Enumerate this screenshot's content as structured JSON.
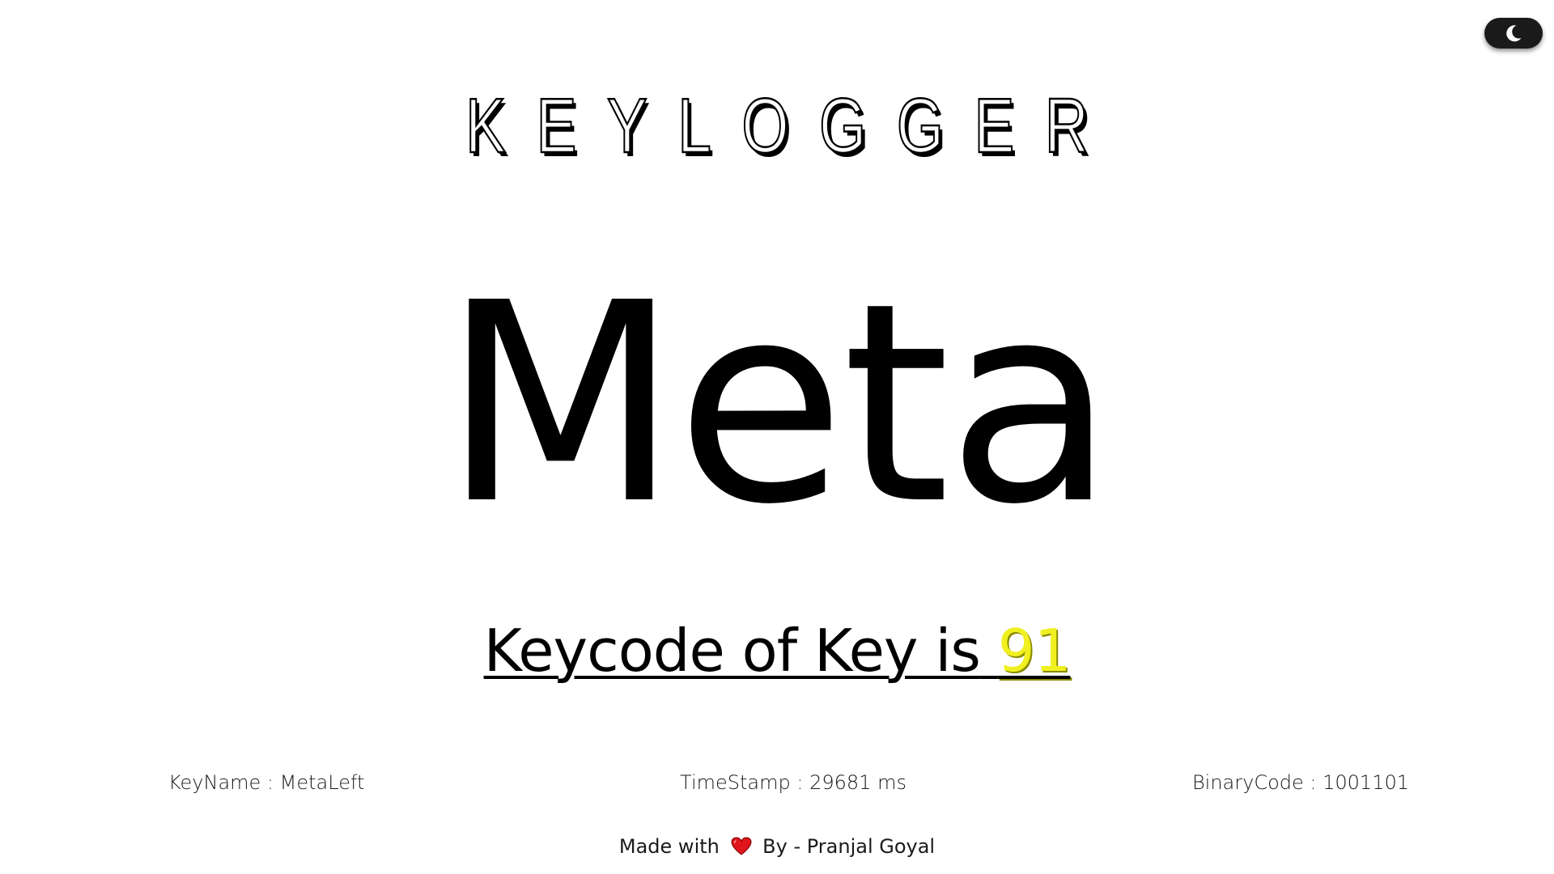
{
  "app": {
    "title": "KEYLOGGER"
  },
  "theme_toggle": {
    "icon": "moon-icon",
    "background": "#1a1a1a",
    "icon_color": "#ffffff"
  },
  "key": {
    "display": "Meta"
  },
  "keycode": {
    "prefix": "Keycode of Key is",
    "value": "91",
    "value_color": "#f0f020"
  },
  "info": {
    "keyname": "KeyName : MetaLeft",
    "timestamp": "TimeStamp : 29681 ms",
    "binary": "BinaryCode : 1001101"
  },
  "footer": {
    "made_with": "Made with",
    "heart_icon": "heart-icon",
    "heart_color": "#e0151c",
    "by": "By - Pranjal Goyal"
  }
}
